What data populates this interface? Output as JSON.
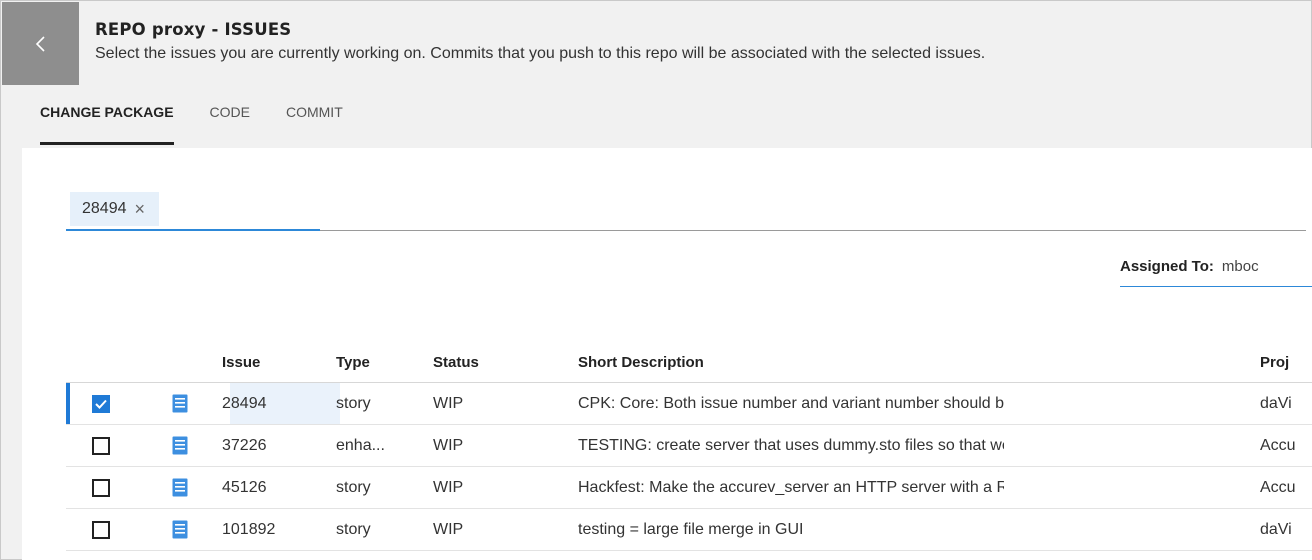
{
  "header": {
    "title": "REPO proxy - ISSUES",
    "subtitle": "Select the issues you are currently working on. Commits that you push to this repo will be associated with the selected issues."
  },
  "tabs": [
    {
      "label": "CHANGE PACKAGE",
      "active": true
    },
    {
      "label": "CODE",
      "active": false
    },
    {
      "label": "COMMIT",
      "active": false
    }
  ],
  "filter": {
    "chip": "28494",
    "chip_close": "×"
  },
  "assigned": {
    "label": "Assigned To:",
    "value": "mboc"
  },
  "table": {
    "columns": {
      "issue": "Issue",
      "type": "Type",
      "status": "Status",
      "desc": "Short Description",
      "proj": "Proj"
    },
    "rows": [
      {
        "checked": true,
        "issue": "28494",
        "type": "story",
        "status": "WIP",
        "desc": "CPK: Core: Both issue number and variant number should be",
        "proj": "daVi"
      },
      {
        "checked": false,
        "issue": "37226",
        "type": "enha...",
        "status": "WIP",
        "desc": "TESTING: create server that uses dummy.sto files so that we",
        "proj": "Accu"
      },
      {
        "checked": false,
        "issue": "45126",
        "type": "story",
        "status": "WIP",
        "desc": "Hackfest: Make the accurev_server an HTTP server with a R",
        "proj": "Accu"
      },
      {
        "checked": false,
        "issue": "101892",
        "type": "story",
        "status": "WIP",
        "desc": "testing = large file merge in GUI",
        "proj": "daVi"
      }
    ]
  },
  "colors": {
    "accent": "#1f7ad6",
    "back_button": "#8e8e8e",
    "chip_bg": "#e6f0fa",
    "icon_blue": "#3d8fe0"
  },
  "icons": {
    "back": "chevron-left-icon",
    "issue_type": "document-icon",
    "check": "checkmark-icon"
  }
}
